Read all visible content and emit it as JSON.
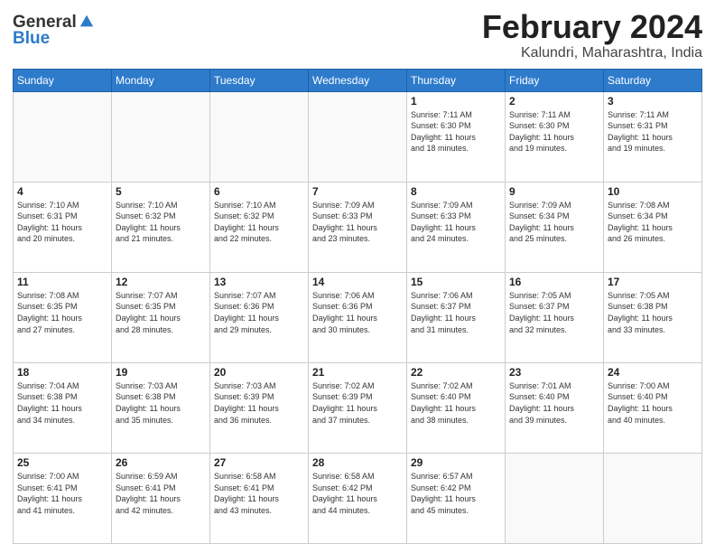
{
  "header": {
    "logo_line1": "General",
    "logo_line2": "Blue",
    "month": "February 2024",
    "location": "Kalundri, Maharashtra, India"
  },
  "weekdays": [
    "Sunday",
    "Monday",
    "Tuesday",
    "Wednesday",
    "Thursday",
    "Friday",
    "Saturday"
  ],
  "weeks": [
    [
      {
        "day": "",
        "info": ""
      },
      {
        "day": "",
        "info": ""
      },
      {
        "day": "",
        "info": ""
      },
      {
        "day": "",
        "info": ""
      },
      {
        "day": "1",
        "info": "Sunrise: 7:11 AM\nSunset: 6:30 PM\nDaylight: 11 hours\nand 18 minutes."
      },
      {
        "day": "2",
        "info": "Sunrise: 7:11 AM\nSunset: 6:30 PM\nDaylight: 11 hours\nand 19 minutes."
      },
      {
        "day": "3",
        "info": "Sunrise: 7:11 AM\nSunset: 6:31 PM\nDaylight: 11 hours\nand 19 minutes."
      }
    ],
    [
      {
        "day": "4",
        "info": "Sunrise: 7:10 AM\nSunset: 6:31 PM\nDaylight: 11 hours\nand 20 minutes."
      },
      {
        "day": "5",
        "info": "Sunrise: 7:10 AM\nSunset: 6:32 PM\nDaylight: 11 hours\nand 21 minutes."
      },
      {
        "day": "6",
        "info": "Sunrise: 7:10 AM\nSunset: 6:32 PM\nDaylight: 11 hours\nand 22 minutes."
      },
      {
        "day": "7",
        "info": "Sunrise: 7:09 AM\nSunset: 6:33 PM\nDaylight: 11 hours\nand 23 minutes."
      },
      {
        "day": "8",
        "info": "Sunrise: 7:09 AM\nSunset: 6:33 PM\nDaylight: 11 hours\nand 24 minutes."
      },
      {
        "day": "9",
        "info": "Sunrise: 7:09 AM\nSunset: 6:34 PM\nDaylight: 11 hours\nand 25 minutes."
      },
      {
        "day": "10",
        "info": "Sunrise: 7:08 AM\nSunset: 6:34 PM\nDaylight: 11 hours\nand 26 minutes."
      }
    ],
    [
      {
        "day": "11",
        "info": "Sunrise: 7:08 AM\nSunset: 6:35 PM\nDaylight: 11 hours\nand 27 minutes."
      },
      {
        "day": "12",
        "info": "Sunrise: 7:07 AM\nSunset: 6:35 PM\nDaylight: 11 hours\nand 28 minutes."
      },
      {
        "day": "13",
        "info": "Sunrise: 7:07 AM\nSunset: 6:36 PM\nDaylight: 11 hours\nand 29 minutes."
      },
      {
        "day": "14",
        "info": "Sunrise: 7:06 AM\nSunset: 6:36 PM\nDaylight: 11 hours\nand 30 minutes."
      },
      {
        "day": "15",
        "info": "Sunrise: 7:06 AM\nSunset: 6:37 PM\nDaylight: 11 hours\nand 31 minutes."
      },
      {
        "day": "16",
        "info": "Sunrise: 7:05 AM\nSunset: 6:37 PM\nDaylight: 11 hours\nand 32 minutes."
      },
      {
        "day": "17",
        "info": "Sunrise: 7:05 AM\nSunset: 6:38 PM\nDaylight: 11 hours\nand 33 minutes."
      }
    ],
    [
      {
        "day": "18",
        "info": "Sunrise: 7:04 AM\nSunset: 6:38 PM\nDaylight: 11 hours\nand 34 minutes."
      },
      {
        "day": "19",
        "info": "Sunrise: 7:03 AM\nSunset: 6:38 PM\nDaylight: 11 hours\nand 35 minutes."
      },
      {
        "day": "20",
        "info": "Sunrise: 7:03 AM\nSunset: 6:39 PM\nDaylight: 11 hours\nand 36 minutes."
      },
      {
        "day": "21",
        "info": "Sunrise: 7:02 AM\nSunset: 6:39 PM\nDaylight: 11 hours\nand 37 minutes."
      },
      {
        "day": "22",
        "info": "Sunrise: 7:02 AM\nSunset: 6:40 PM\nDaylight: 11 hours\nand 38 minutes."
      },
      {
        "day": "23",
        "info": "Sunrise: 7:01 AM\nSunset: 6:40 PM\nDaylight: 11 hours\nand 39 minutes."
      },
      {
        "day": "24",
        "info": "Sunrise: 7:00 AM\nSunset: 6:40 PM\nDaylight: 11 hours\nand 40 minutes."
      }
    ],
    [
      {
        "day": "25",
        "info": "Sunrise: 7:00 AM\nSunset: 6:41 PM\nDaylight: 11 hours\nand 41 minutes."
      },
      {
        "day": "26",
        "info": "Sunrise: 6:59 AM\nSunset: 6:41 PM\nDaylight: 11 hours\nand 42 minutes."
      },
      {
        "day": "27",
        "info": "Sunrise: 6:58 AM\nSunset: 6:41 PM\nDaylight: 11 hours\nand 43 minutes."
      },
      {
        "day": "28",
        "info": "Sunrise: 6:58 AM\nSunset: 6:42 PM\nDaylight: 11 hours\nand 44 minutes."
      },
      {
        "day": "29",
        "info": "Sunrise: 6:57 AM\nSunset: 6:42 PM\nDaylight: 11 hours\nand 45 minutes."
      },
      {
        "day": "",
        "info": ""
      },
      {
        "day": "",
        "info": ""
      }
    ]
  ]
}
